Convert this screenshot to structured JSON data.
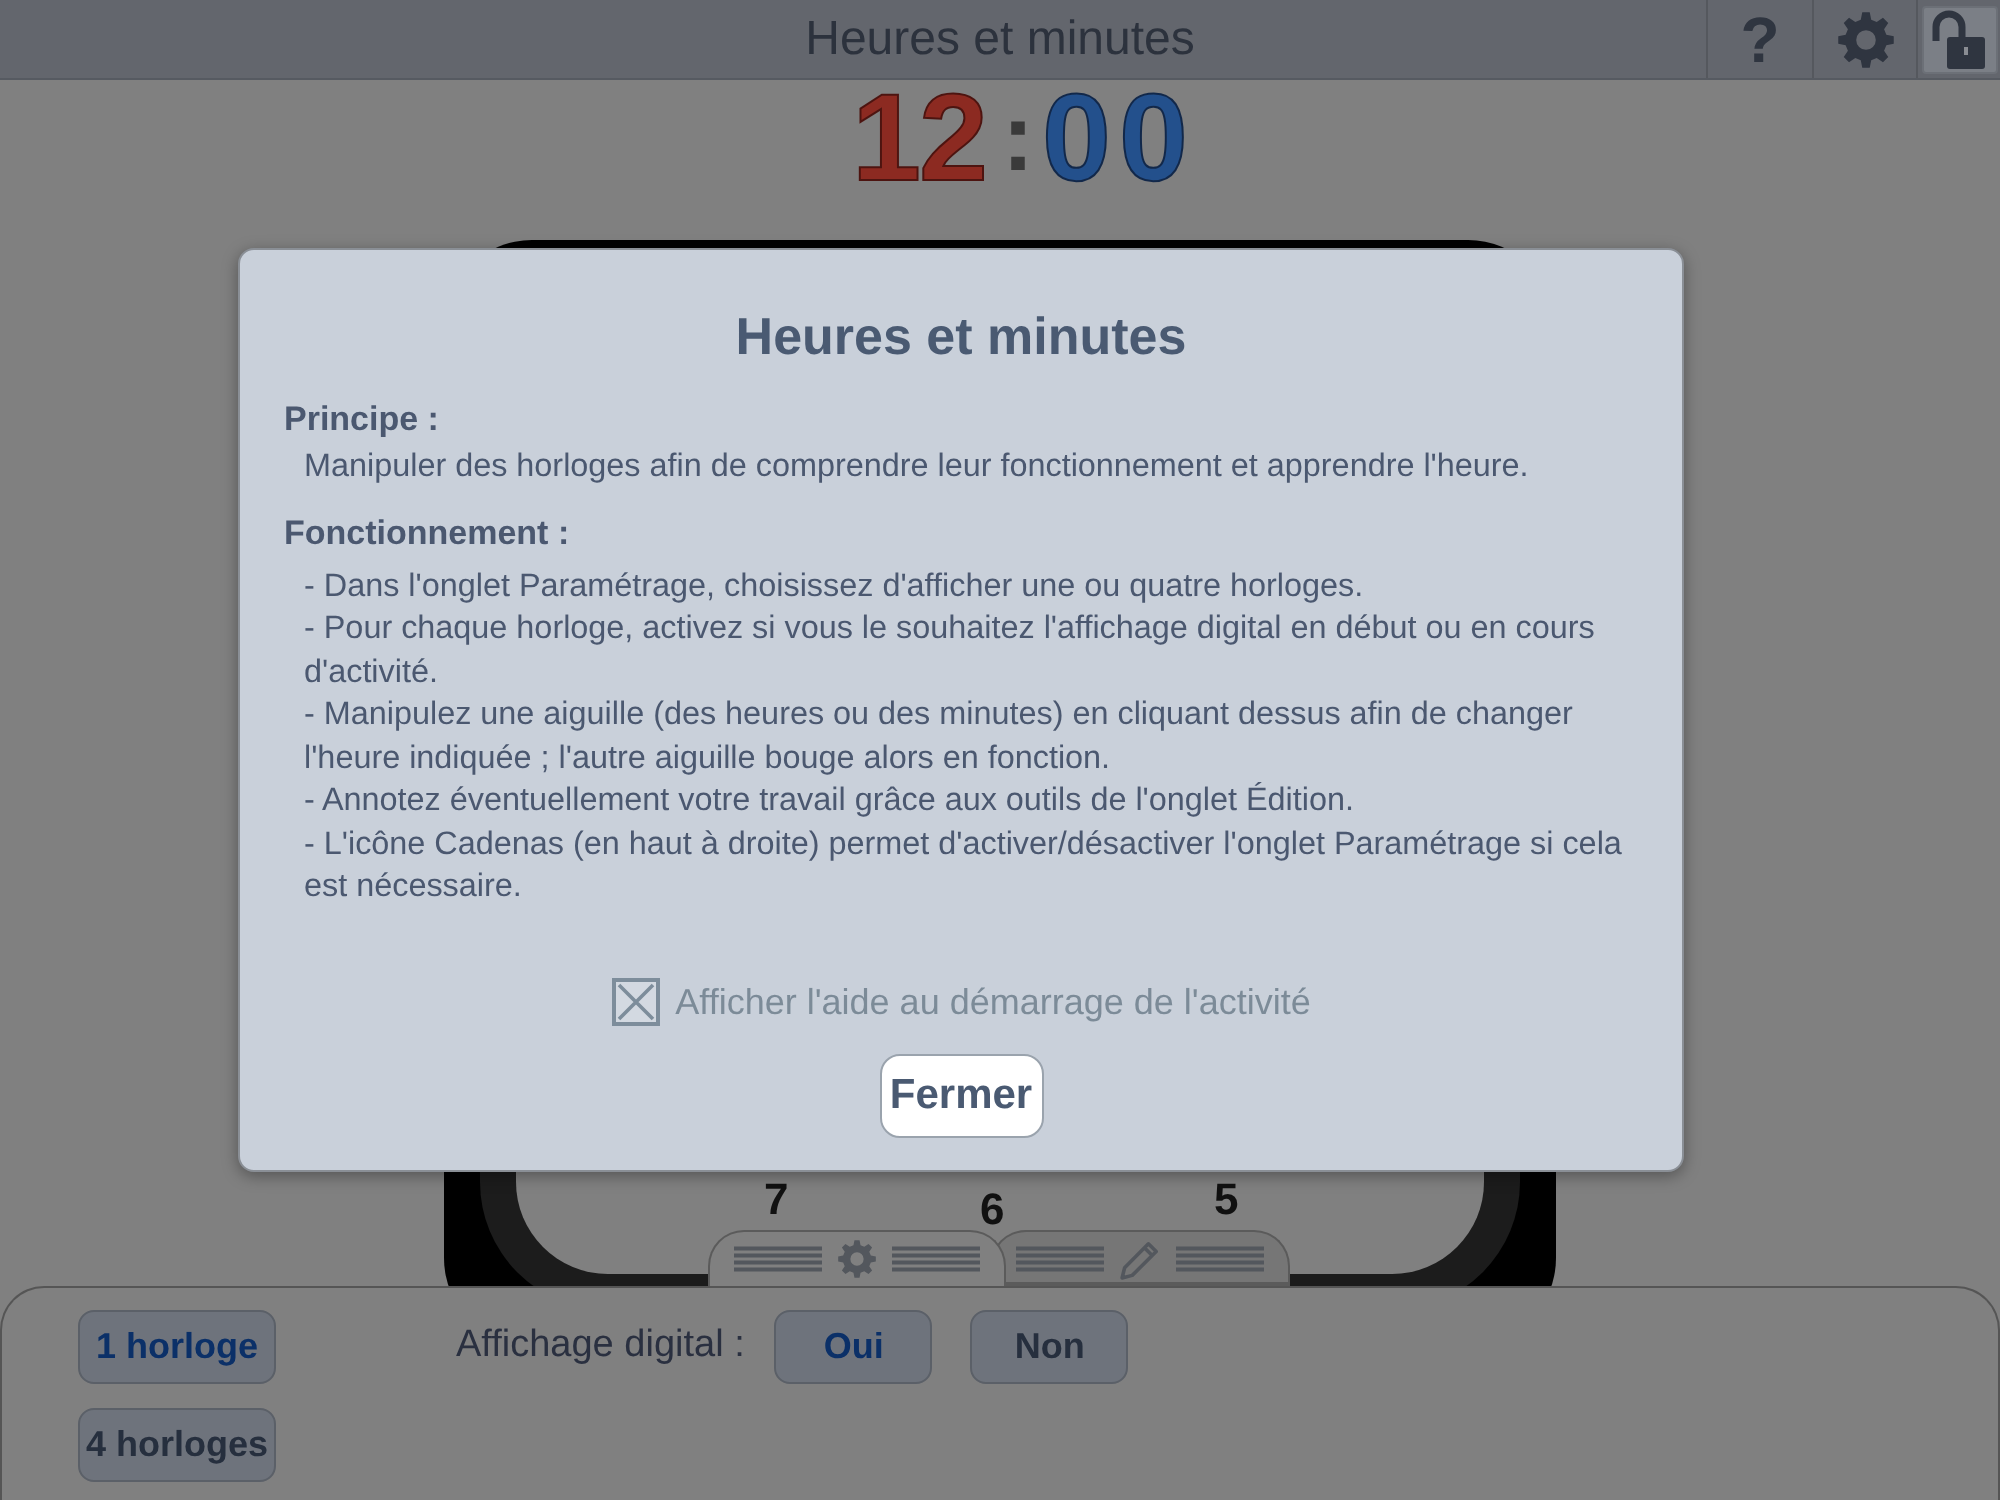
{
  "top_bar": {
    "title": "Heures et minutes",
    "buttons": [
      {
        "kind": "help",
        "label": "?",
        "selected": false
      },
      {
        "kind": "settings",
        "selected": false
      },
      {
        "kind": "lock",
        "selected": true
      }
    ]
  },
  "digital_clock": {
    "hours": "12",
    "separator": ":",
    "minutes": "00"
  },
  "clock": {
    "numerals": [
      "7",
      "6",
      "5"
    ]
  },
  "tabs": [
    {
      "kind": "settings",
      "selected": true
    },
    {
      "kind": "edit",
      "selected": false
    }
  ],
  "panel": {
    "clock_options": [
      {
        "label": "1 horloge",
        "selected": true
      },
      {
        "label": "4 horloges",
        "selected": false
      }
    ],
    "digital_display": {
      "label": "Affichage digital :",
      "options": [
        {
          "label": "Oui",
          "selected": true
        },
        {
          "label": "Non",
          "selected": false
        }
      ]
    }
  },
  "dialog": {
    "title": "Heures et minutes",
    "sections": [
      {
        "heading": "Principe :",
        "paragraphs": [
          "Manipuler des horloges afin de comprendre leur fonctionnement et apprendre l'heure."
        ]
      },
      {
        "heading": "Fonctionnement :",
        "paragraphs": [
          "- Dans l'onglet Paramétrage, choisissez d'afficher une ou quatre horloges.",
          "- Pour chaque horloge, activez si vous le souhaitez l'affichage digital en début ou en cours d'activité.",
          "- Manipulez une aiguille (des heures ou des minutes) en cliquant dessus afin de changer l'heure indiquée ; l'autre aiguille bouge alors en fonction.",
          "- Annotez éventuellement votre travail grâce aux outils de l'onglet Édition.",
          "- L'icône Cadenas (en haut à droite) permet d'activer/désactiver l'onglet Paramétrage si cela est nécessaire."
        ]
      }
    ],
    "startup_checkbox": {
      "label": "Afficher l'aide au démarrage de l'activité",
      "checked": true
    },
    "close_button": {
      "label": "Fermer"
    }
  }
}
